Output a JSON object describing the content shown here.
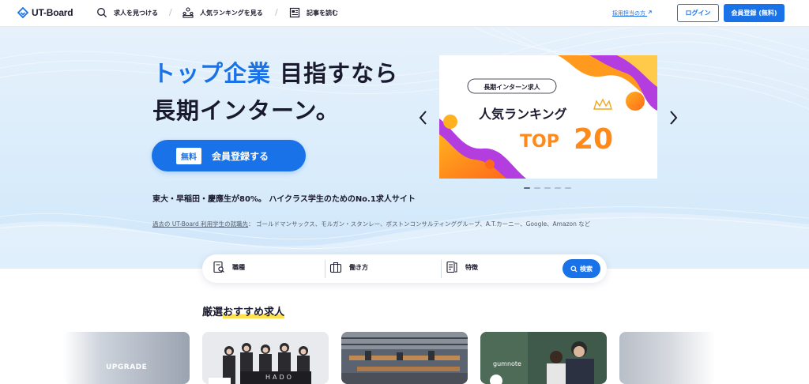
{
  "header": {
    "logo_text": "UT-Board",
    "nav": [
      {
        "label": "求人を見つける",
        "icon": "search-icon"
      },
      {
        "label": "人気ランキングを見る",
        "icon": "ranking-icon"
      },
      {
        "label": "記事を読む",
        "icon": "article-icon"
      }
    ],
    "separator": "/",
    "recruiter_link": "採用担当の方",
    "login_label": "ログイン",
    "register_label": "会員登録 (無料)"
  },
  "hero": {
    "headline_accent": "トップ企業",
    "headline_rest": " 目指すなら",
    "headline_line2": "長期インターン。",
    "cta_badge": "無料",
    "cta_label": "会員登録する",
    "tagline": "東大・早稲田・慶應生が80%。 ハイクラス学生のためのNo.1求人サイト",
    "alumni_link": "過去の UT-Board 利用学生の就職先",
    "alumni_companies": "： ゴールドマンサックス、モルガン・スタンレー、ボストンコンサルティンググループ、A.T.カーニー、Google、Amazon など"
  },
  "banner": {
    "subtitle": "長期インターン求人",
    "title": "人気ランキング",
    "top_word": "TOP",
    "top_number": "20",
    "slide_count": 5,
    "active_slide": 1
  },
  "search": {
    "fields": [
      {
        "label": "職種",
        "icon": "job-type-icon"
      },
      {
        "label": "働き方",
        "icon": "work-style-icon"
      },
      {
        "label": "特徴",
        "icon": "feature-icon"
      }
    ],
    "button_label": "検索"
  },
  "recommended": {
    "title_prefix": "厳選",
    "title_highlight": "おすすめ求人",
    "cards": [
      {
        "caption": "UPGRADE"
      },
      {
        "caption": "HADO"
      },
      {
        "caption": ""
      },
      {
        "caption": "gumnote"
      },
      {
        "caption": ""
      }
    ]
  },
  "colors": {
    "brand": "#1a72e8",
    "text": "#1a1a2e",
    "highlight": "#ffe14d",
    "hero_bg": "#dcecfb"
  }
}
